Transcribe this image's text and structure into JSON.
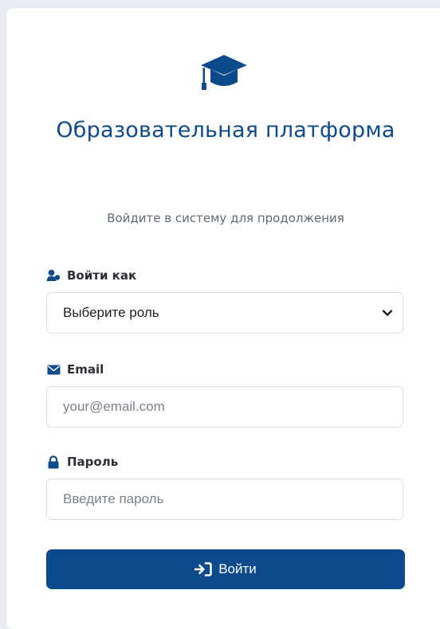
{
  "header": {
    "title": "Образовательная платформа",
    "subtitle": "Войдите в систему для продолжения"
  },
  "role": {
    "label": "Войти как",
    "selected": "Выберите роль"
  },
  "email": {
    "label": "Email",
    "placeholder": "your@email.com",
    "value": ""
  },
  "password": {
    "label": "Пароль",
    "placeholder": "Введите пароль",
    "value": ""
  },
  "submit": {
    "label": "Войти"
  },
  "colors": {
    "primary": "#0d4a8c",
    "text": "#2b2f35",
    "muted": "#606975",
    "border": "#d9dee5",
    "background": "#e9edf3"
  },
  "icons": {
    "logo": "graduation-cap-icon",
    "role": "user-icon",
    "email": "envelope-icon",
    "password": "lock-icon",
    "submit": "sign-in-icon",
    "dropdown": "chevron-down-icon"
  }
}
